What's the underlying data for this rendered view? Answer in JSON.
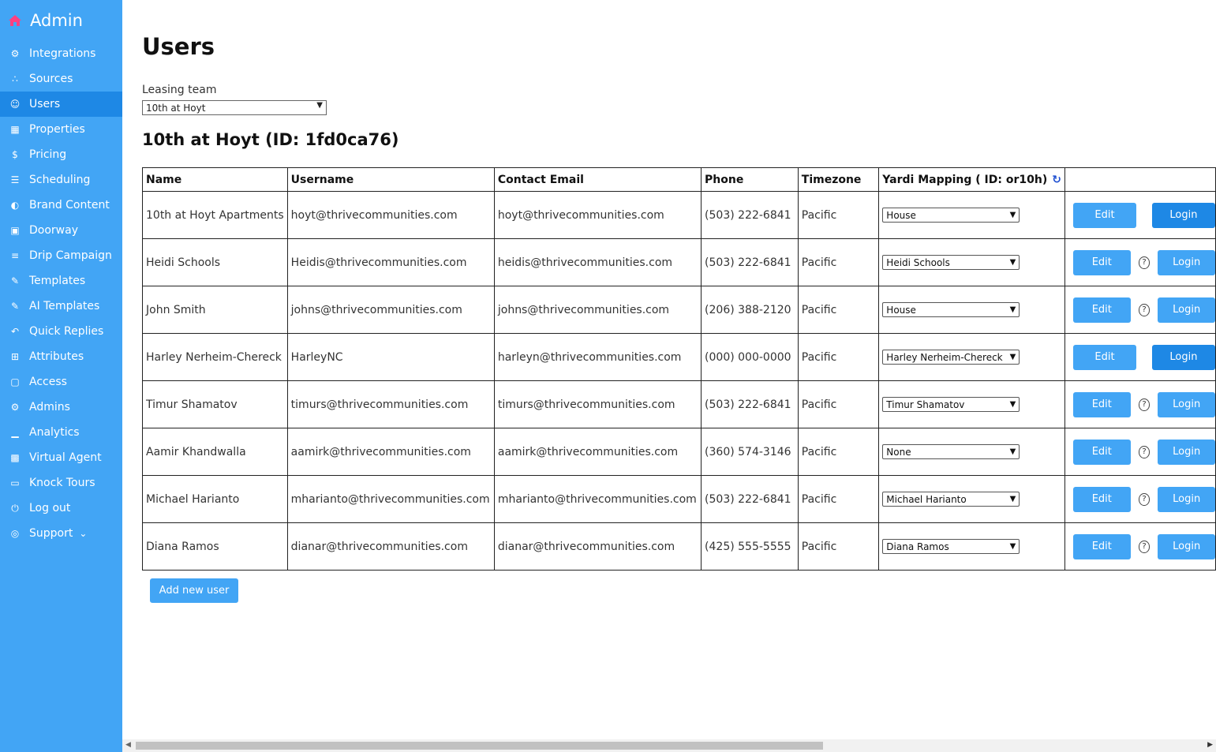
{
  "sidebar": {
    "brand": "Admin",
    "brand_icon": "home-icon",
    "items": [
      {
        "label": "Integrations",
        "icon": "cogs-icon"
      },
      {
        "label": "Sources",
        "icon": "share-icon"
      },
      {
        "label": "Users",
        "icon": "users-icon"
      },
      {
        "label": "Properties",
        "icon": "building-icon"
      },
      {
        "label": "Pricing",
        "icon": "dollar-icon"
      },
      {
        "label": "Scheduling",
        "icon": "sliders-icon"
      },
      {
        "label": "Brand Content",
        "icon": "palette-icon"
      },
      {
        "label": "Doorway",
        "icon": "calendar-icon"
      },
      {
        "label": "Drip Campaign",
        "icon": "list-icon"
      },
      {
        "label": "Templates",
        "icon": "edit-icon"
      },
      {
        "label": "AI Templates",
        "icon": "edit-icon"
      },
      {
        "label": "Quick Replies",
        "icon": "reply-icon"
      },
      {
        "label": "Attributes",
        "icon": "table-icon"
      },
      {
        "label": "Access",
        "icon": "lock-icon"
      },
      {
        "label": "Admins",
        "icon": "cogs-icon"
      },
      {
        "label": "Analytics",
        "icon": "chart-icon"
      },
      {
        "label": "Virtual Agent",
        "icon": "robot-icon"
      },
      {
        "label": "Knock Tours",
        "icon": "map-icon"
      },
      {
        "label": "Log out",
        "icon": "power-icon"
      },
      {
        "label": "Support",
        "icon": "lifering-icon"
      }
    ],
    "active_color": "#1e88e5",
    "bg_color": "#42a5f5"
  },
  "page": {
    "title": "Users",
    "team_label": "Leasing team",
    "team_selected": "10th at Hoyt",
    "subtitle": "10th at Hoyt (ID: 1fd0ca76)"
  },
  "table": {
    "headers": {
      "name": "Name",
      "username": "Username",
      "email": "Contact Email",
      "phone": "Phone",
      "timezone": "Timezone",
      "yardi": "Yardi Mapping ( ID: or10h)"
    },
    "rows": [
      {
        "name": "10th at Hoyt Apartments",
        "username": "hoyt@thrivecommunities.com",
        "email": "hoyt@thrivecommunities.com",
        "phone": "(503) 222-6841",
        "timezone": "Pacific",
        "yardi": "House",
        "edit": "Edit",
        "login": "Login"
      },
      {
        "name": "Heidi Schools",
        "username": "Heidis@thrivecommunities.com",
        "email": "heidis@thrivecommunities.com",
        "phone": "(503) 222-6841",
        "timezone": "Pacific",
        "yardi": "Heidi Schools",
        "edit": "Edit",
        "login": "Login",
        "help": "?"
      },
      {
        "name": "John Smith",
        "username": "johns@thrivecommunities.com",
        "email": "johns@thrivecommunities.com",
        "phone": "(206) 388-2120",
        "timezone": "Pacific",
        "yardi": "House",
        "edit": "Edit",
        "login": "Login",
        "help": "?"
      },
      {
        "name": "Harley Nerheim-Chereck",
        "username": "HarleyNC",
        "email": "harleyn@thrivecommunities.com",
        "phone": "(000) 000-0000",
        "timezone": "Pacific",
        "yardi": "Harley Nerheim-Chereck",
        "edit": "Edit",
        "login": "Login"
      },
      {
        "name": "Timur Shamatov",
        "username": "timurs@thrivecommunities.com",
        "email": "timurs@thrivecommunities.com",
        "phone": "(503) 222-6841",
        "timezone": "Pacific",
        "yardi": "Timur Shamatov",
        "edit": "Edit",
        "login": "Login",
        "help": "?"
      },
      {
        "name": "Aamir Khandwalla",
        "username": "aamirk@thrivecommunities.com",
        "email": "aamirk@thrivecommunities.com",
        "phone": "(360) 574-3146",
        "timezone": "Pacific",
        "yardi": "None",
        "edit": "Edit",
        "login": "Login",
        "help": "?"
      },
      {
        "name": "Michael Harianto",
        "username": "mharianto@thrivecommunities.com",
        "email": "mharianto@thrivecommunities.com",
        "phone": "(503) 222-6841",
        "timezone": "Pacific",
        "yardi": "Michael Harianto",
        "edit": "Edit",
        "login": "Login",
        "help": "?"
      },
      {
        "name": "Diana Ramos",
        "username": "dianar@thrivecommunities.com",
        "email": "dianar@thrivecommunities.com",
        "phone": "(425) 555-5555",
        "timezone": "Pacific",
        "yardi": "Diana Ramos",
        "edit": "Edit",
        "login": "Login",
        "help": "?"
      }
    ]
  },
  "add_user_label": "Add new user"
}
